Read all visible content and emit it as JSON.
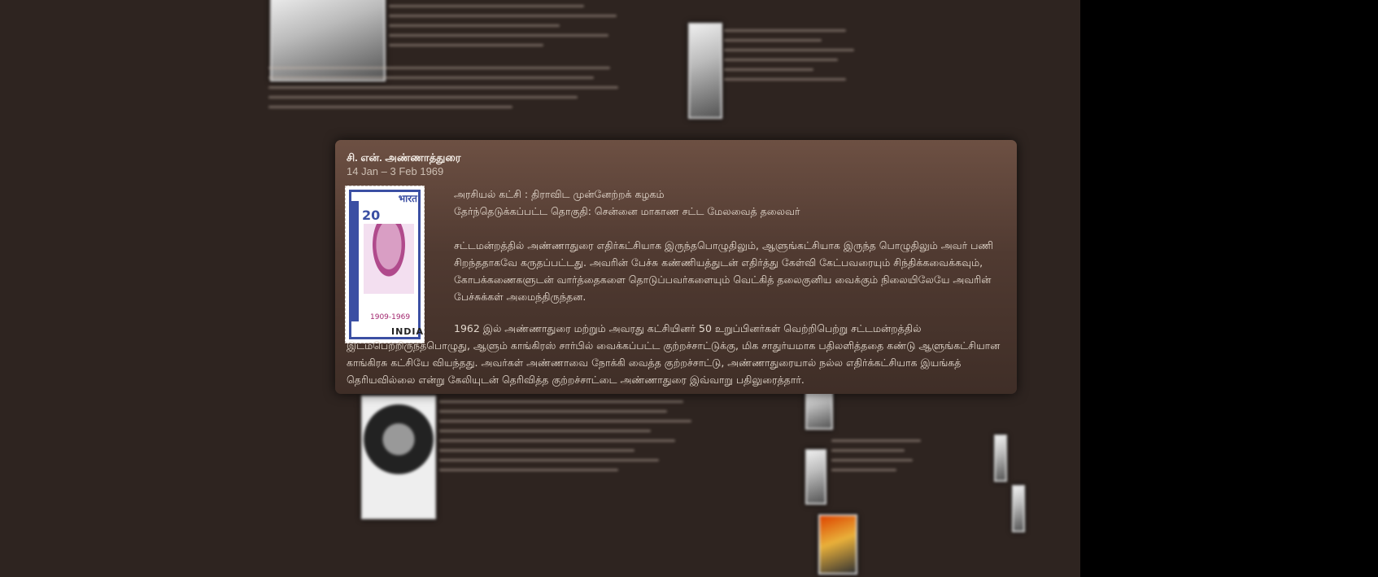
{
  "panel": {
    "name": "சி. என். அண்ணாத்துரை",
    "dates": "14 Jan – 3 Feb 1969",
    "party": "அரசியல் கட்சி : திராவிட முன்னேற்றக் கழகம்",
    "constituency": "தேர்ந்தெடுக்கப்பட்ட தொகுதி: சென்னை மாகாண சட்ட மேலவைத் தலைவர்",
    "paragraph1": "சட்டமன்றத்தில் அண்ணாதுரை எதிர்கட்சியாக இருந்தபொழுதிலும், ஆளுங்கட்சியாக இருந்த பொழுதிலும் அவர் பணி சிறந்ததாகவே கருதப்பட்டது. அவரின் பேச்சு கண்ணியத்துடன் எதிர்த்து கேள்வி கேட்பவரையும் சிந்திக்கவைக்கவும், கோபக்கணைகளுடன் வார்த்தைகளை தொடுப்பவர்களையும் வெட்கித் தலைகுனிய வைக்கும் நிலையிலேயே அவரின் பேச்சுக்கள் அமைந்திருந்தன.",
    "paragraph2": "1962 இல் அண்ணாதுரை மற்றும் அவரது கட்சியினர் 50 உறுப்பினர்கள் வெற்றிபெற்று சட்டமன்றத்தில் இடம்பெற்றிருந்தபொழுது, ஆளும் காங்கிரஸ் சார்பில் வைக்கப்பட்ட குற்றச்சாட்டுக்கு, மிக சாதுர்யமாக பதிலளித்ததை கண்டு ஆளுங்கட்சியான காங்கிரசு கட்சியே வியந்தது. அவர்கள் அண்ணாவை நோக்கி வைத்த குற்றச்சாட்டு, அண்ணாதுரையால் நல்ல எதிர்க்கட்சியாக இயங்கத் தெரியவில்லை என்று கேலியுடன் தெரிவித்த குற்றச்சாட்டை அண்ணாதுரை இவ்வாறு பதிலுரைத்தார்.",
    "stamp": {
      "script_top": "भारत",
      "value": "20",
      "years": "1909-1969",
      "country": "INDIA"
    }
  }
}
